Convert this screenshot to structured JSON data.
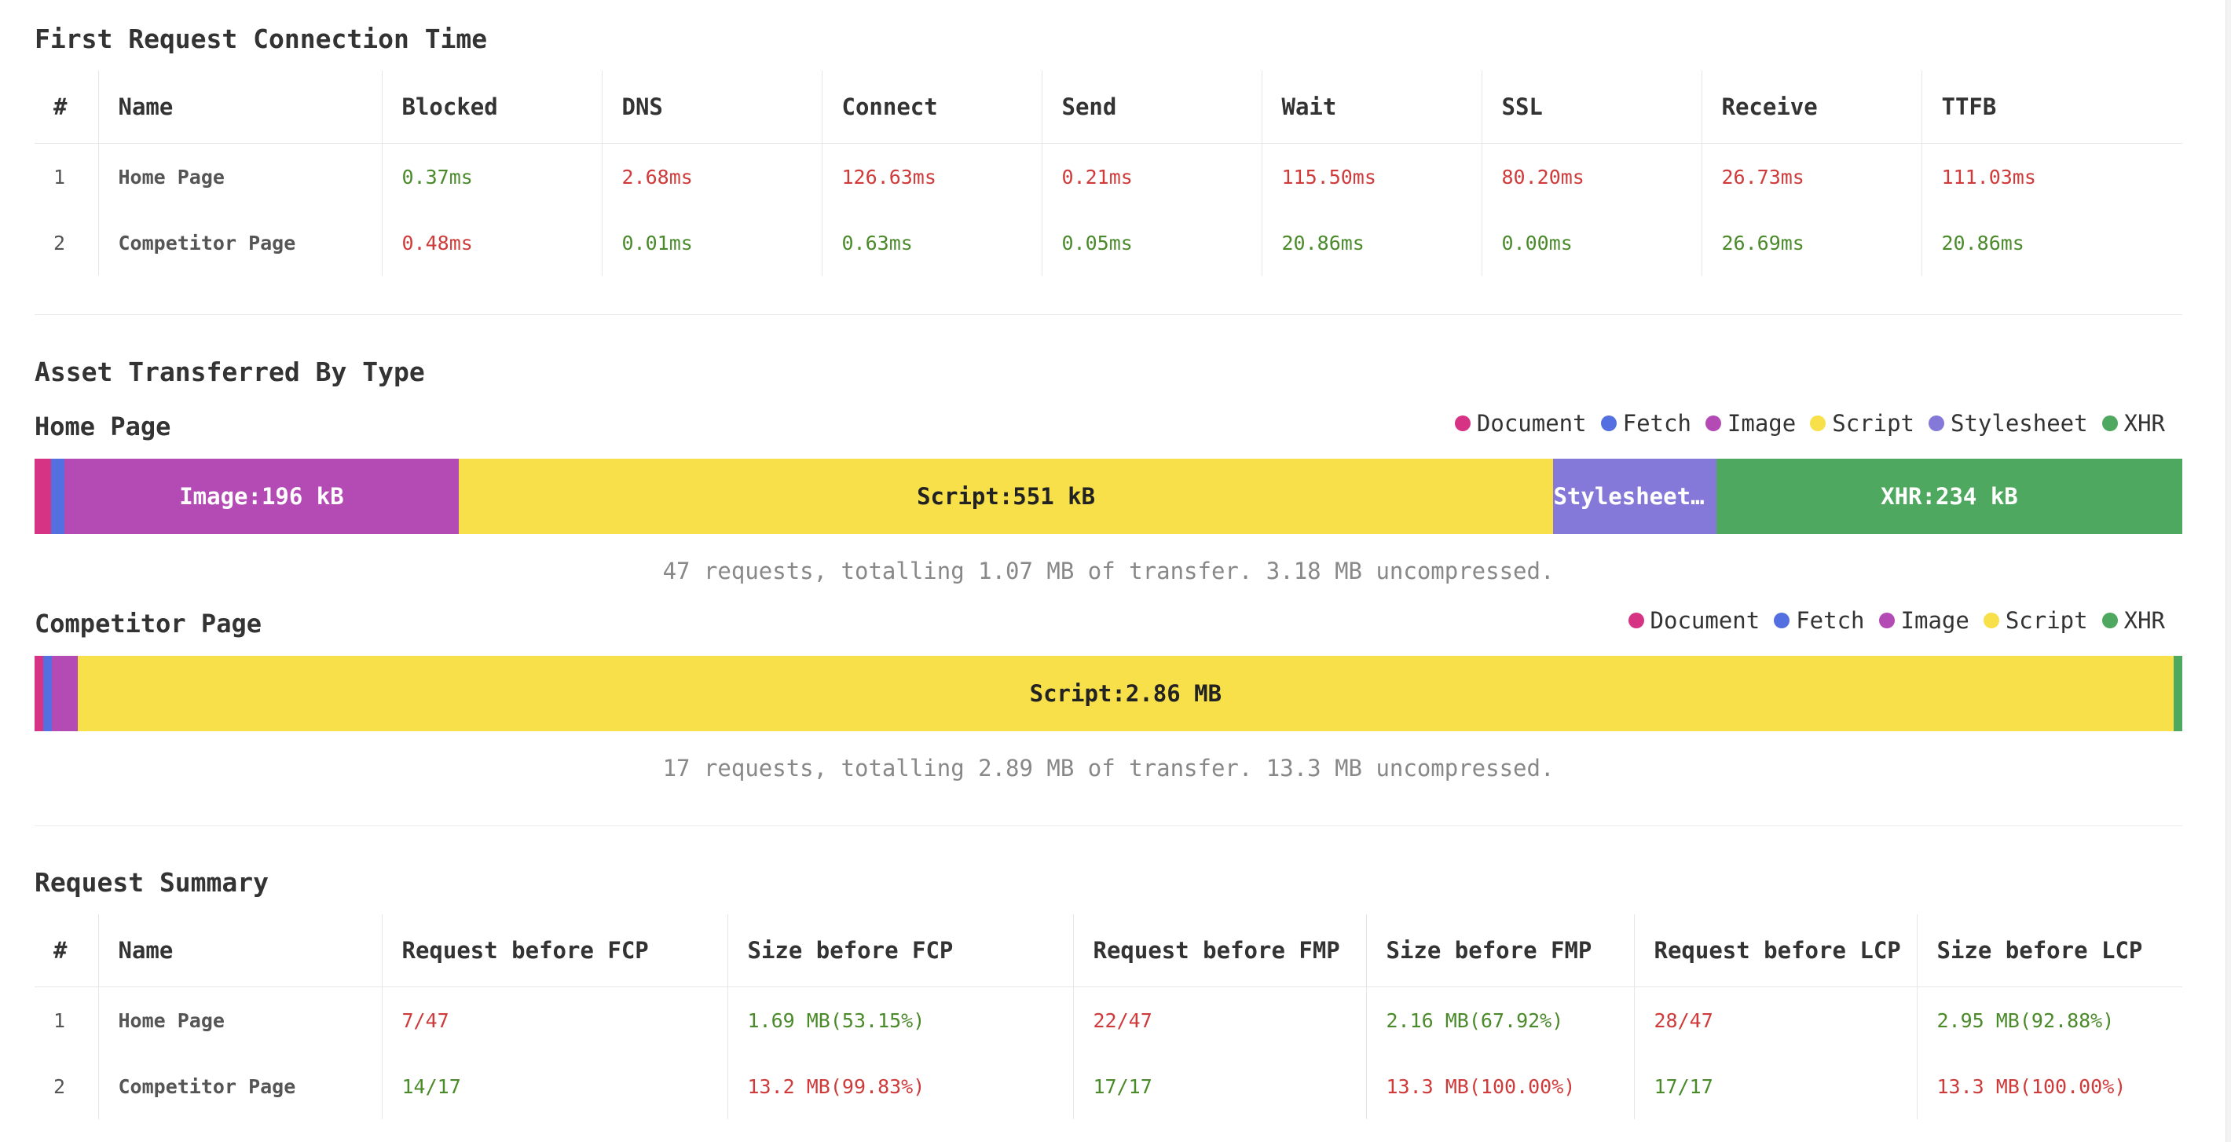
{
  "connection": {
    "title": "First Request Connection Time",
    "headers": [
      "#",
      "Name",
      "Blocked",
      "DNS",
      "Connect",
      "Send",
      "Wait",
      "SSL",
      "Receive",
      "TTFB"
    ],
    "rows": [
      {
        "num": "1",
        "name": "Home Page",
        "cells": [
          {
            "v": "0.37ms",
            "s": "good"
          },
          {
            "v": "2.68ms",
            "s": "bad"
          },
          {
            "v": "126.63ms",
            "s": "bad"
          },
          {
            "v": "0.21ms",
            "s": "bad"
          },
          {
            "v": "115.50ms",
            "s": "bad"
          },
          {
            "v": "80.20ms",
            "s": "bad"
          },
          {
            "v": "26.73ms",
            "s": "bad"
          },
          {
            "v": "111.03ms",
            "s": "bad"
          }
        ]
      },
      {
        "num": "2",
        "name": "Competitor Page",
        "cells": [
          {
            "v": "0.48ms",
            "s": "bad"
          },
          {
            "v": "0.01ms",
            "s": "good"
          },
          {
            "v": "0.63ms",
            "s": "good"
          },
          {
            "v": "0.05ms",
            "s": "good"
          },
          {
            "v": "20.86ms",
            "s": "good"
          },
          {
            "v": "0.00ms",
            "s": "good"
          },
          {
            "v": "26.69ms",
            "s": "good"
          },
          {
            "v": "20.86ms",
            "s": "good"
          }
        ]
      }
    ]
  },
  "assets": {
    "title": "Asset Transferred By Type",
    "colors": {
      "Document": "#d63384",
      "Fetch": "#5470e0",
      "Image": "#b44ab4",
      "Script": "#f8e04a",
      "Stylesheet": "#8479d8",
      "XHR": "#4fa85f"
    },
    "pages": [
      {
        "label": "Home Page",
        "legend": [
          "Document",
          "Fetch",
          "Image",
          "Script",
          "Stylesheet",
          "XHR"
        ],
        "segments": [
          {
            "type": "Document",
            "fraction": 0.0075,
            "label": ""
          },
          {
            "type": "Fetch",
            "fraction": 0.0065,
            "label": ""
          },
          {
            "type": "Image",
            "fraction": 0.1834,
            "label": "Image:196 kB"
          },
          {
            "type": "Script",
            "fraction": 0.5098,
            "label": "Script:551 kB"
          },
          {
            "type": "Stylesheet",
            "fraction": 0.0759,
            "label": "Stylesheet:…"
          },
          {
            "type": "XHR",
            "fraction": 0.2169,
            "label": "XHR:234 kB"
          }
        ],
        "caption": "47 requests, totalling 1.07 MB of transfer. 3.18 MB uncompressed."
      },
      {
        "label": "Competitor Page",
        "legend": [
          "Document",
          "Fetch",
          "Image",
          "Script",
          "XHR"
        ],
        "segments": [
          {
            "type": "Document",
            "fraction": 0.004,
            "label": ""
          },
          {
            "type": "Fetch",
            "fraction": 0.004,
            "label": ""
          },
          {
            "type": "Image",
            "fraction": 0.012,
            "label": ""
          },
          {
            "type": "Script",
            "fraction": 0.976,
            "label": "Script:2.86 MB"
          },
          {
            "type": "XHR",
            "fraction": 0.004,
            "label": ""
          }
        ],
        "caption": "17 requests, totalling 2.89 MB of transfer. 13.3 MB uncompressed."
      }
    ]
  },
  "summary": {
    "title": "Request Summary",
    "headers": [
      "#",
      "Name",
      "Request before FCP",
      "Size before FCP",
      "Request before FMP",
      "Size before FMP",
      "Request before LCP",
      "Size before LCP"
    ],
    "rows": [
      {
        "num": "1",
        "name": "Home Page",
        "cells": [
          {
            "v": "7/47",
            "s": "bad"
          },
          {
            "v": "1.69 MB(53.15%)",
            "s": "good"
          },
          {
            "v": "22/47",
            "s": "bad"
          },
          {
            "v": "2.16 MB(67.92%)",
            "s": "good"
          },
          {
            "v": "28/47",
            "s": "bad"
          },
          {
            "v": "2.95 MB(92.88%)",
            "s": "good"
          }
        ]
      },
      {
        "num": "2",
        "name": "Competitor Page",
        "cells": [
          {
            "v": "14/17",
            "s": "good"
          },
          {
            "v": "13.2 MB(99.83%)",
            "s": "bad"
          },
          {
            "v": "17/17",
            "s": "good"
          },
          {
            "v": "13.3 MB(100.00%)",
            "s": "bad"
          },
          {
            "v": "17/17",
            "s": "good"
          },
          {
            "v": "13.3 MB(100.00%)",
            "s": "bad"
          }
        ]
      }
    ]
  }
}
